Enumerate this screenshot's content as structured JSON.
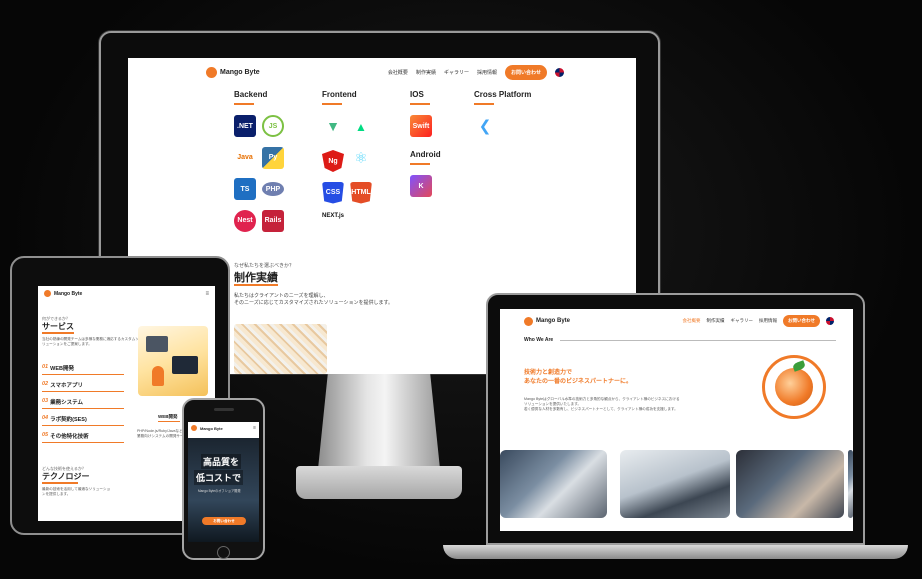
{
  "brand": {
    "name": "Mango Byte",
    "accent": "#f07a28"
  },
  "nav": {
    "items": [
      "会社概要",
      "制作実績",
      "ギャラリー",
      "採用情報"
    ],
    "cta": "お問い合わせ"
  },
  "desktop": {
    "columns": [
      {
        "title": "Backend",
        "icons": [
          ".NET",
          "JS",
          "Java",
          "Py",
          "TS",
          "PHP",
          "Nest",
          "Rails"
        ]
      },
      {
        "title": "Frontend",
        "icons": [
          "Vue",
          "Nuxt",
          "Ng",
          "React",
          "CSS",
          "HTML"
        ],
        "next_label": "NEXT.js"
      },
      {
        "title": "IOS",
        "icons": [
          "Swift"
        ]
      },
      {
        "title": "Android",
        "icons": [
          "K"
        ]
      },
      {
        "title": "Cross Platform",
        "icons": [
          "Flutter"
        ]
      }
    ],
    "why_small": "なぜ私たちを選ぶべきか？",
    "works_title": "制作実績",
    "works_desc_1": "私たちはクライアントのニーズを理解し、",
    "works_desc_2": "そのニーズに応じてカスタマイズされたソリューションを提供します。"
  },
  "tablet": {
    "services_small": "何ができるか？",
    "services_title": "サービス",
    "services_desc": "当社の熟練の開発チームは多様な業務に適応するカスタムソリューションをご提案します。",
    "services": [
      {
        "num": "01",
        "label": "WEB開発"
      },
      {
        "num": "02",
        "label": "スマホアプリ"
      },
      {
        "num": "03",
        "label": "業務システム"
      },
      {
        "num": "04",
        "label": "ラボ契約(SES)"
      },
      {
        "num": "05",
        "label": "その他特化技術"
      }
    ],
    "web_label": "WEB開発",
    "web_desc": "PHP/Node.js/Ruby/Javaなどの言語を使用した業務向けシステムの開発サービス",
    "tech_small": "どんな技術を使えるか？",
    "tech_title": "テクノロジー",
    "tech_desc": "最新の技術を活用して最適なソリューションを提供します。"
  },
  "phone": {
    "hero_1": "高品質を",
    "hero_2": "低コストで",
    "hero_sub": "Mango Byteのオフショア開発",
    "cta": "お問い合わせ"
  },
  "laptop": {
    "section": "Who We Are",
    "tag_1": "技術力と創造力で",
    "tag_2": "あなたの一番のビジネスパートナーに。",
    "body": "Mango Byteはグローバル水準の技術力と多角的な観点から、クライアント様のビジネスにおけるソリューションを提供いたします。",
    "body_2": "若く優秀な人材を多数有し、ビジネスパートナーとして、クライアント様の成功を支援します。"
  }
}
